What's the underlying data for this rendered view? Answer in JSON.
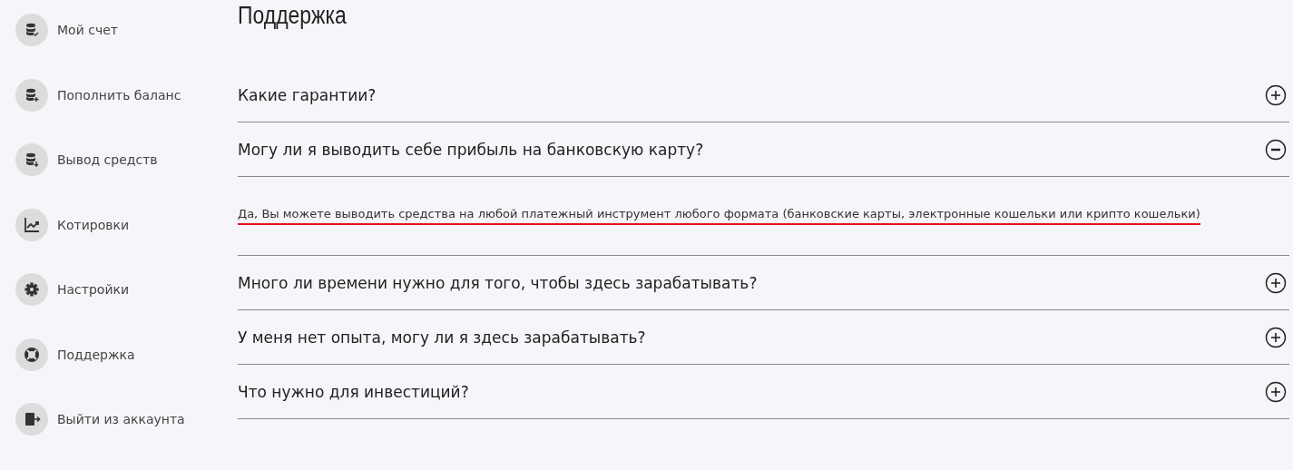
{
  "sidebar": {
    "items": [
      {
        "label": "Мой счет"
      },
      {
        "label": "Пополнить баланс"
      },
      {
        "label": "Вывод средств"
      },
      {
        "label": "Котировки"
      },
      {
        "label": "Настройки"
      },
      {
        "label": "Поддержка"
      },
      {
        "label": "Выйти из аккаунта"
      }
    ]
  },
  "page_title": "Поддержка",
  "faq": [
    {
      "question": "Какие гарантии?",
      "expanded": false
    },
    {
      "question": "Могу ли я выводить себе прибыль на банковскую карту?",
      "expanded": true,
      "answer": "Да, Вы можете выводить средства на любой платежный инструмент любого формата (банковские карты, электронные кошельки или крипто кошельки)",
      "underlined": true
    },
    {
      "question": "Много ли времени нужно для того, чтобы здесь зарабатывать?",
      "expanded": false
    },
    {
      "question": "У меня нет опыта, могу ли я здесь зарабатывать?",
      "expanded": false
    },
    {
      "question": "Что нужно для инвестиций?",
      "expanded": false
    }
  ]
}
